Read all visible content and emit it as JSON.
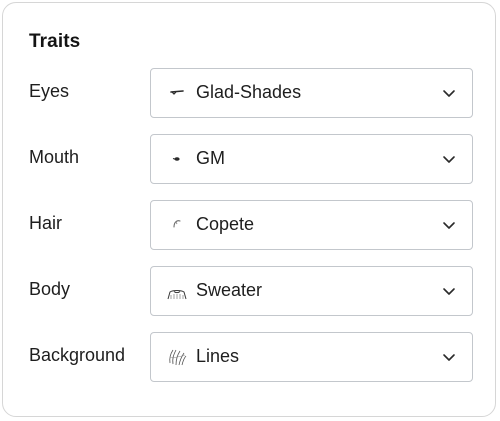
{
  "panel": {
    "title": "Traits"
  },
  "traits": [
    {
      "label": "Eyes",
      "value": "Glad-Shades",
      "icon": "glad-shades-thumbnail"
    },
    {
      "label": "Mouth",
      "value": "GM",
      "icon": "gm-mouth-thumbnail"
    },
    {
      "label": "Hair",
      "value": "Copete",
      "icon": "copete-hair-thumbnail"
    },
    {
      "label": "Body",
      "value": "Sweater",
      "icon": "sweater-thumbnail"
    },
    {
      "label": "Background",
      "value": "Lines",
      "icon": "lines-background-thumbnail"
    }
  ],
  "colors": {
    "border": "#c3c7cc",
    "card_border": "#d6d6d6",
    "text": "#1e1e1e"
  }
}
